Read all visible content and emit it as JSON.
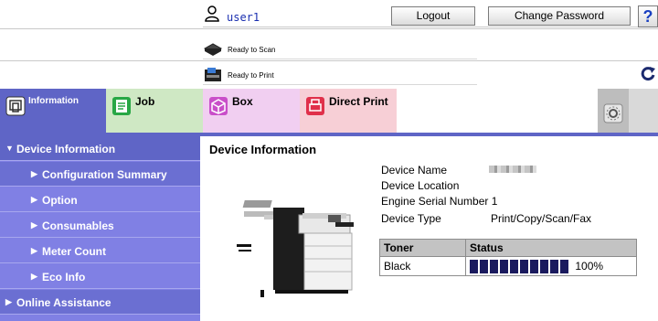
{
  "header": {
    "user_name": "user1",
    "logout_label": "Logout",
    "change_password_label": "Change Password",
    "help_label": "?",
    "scan_status": "Ready to Scan",
    "print_status": "Ready to Print"
  },
  "tabs": [
    {
      "label": "Information"
    },
    {
      "label": "Job"
    },
    {
      "label": "Box"
    },
    {
      "label": "Direct Print"
    }
  ],
  "sidebar": {
    "items": [
      {
        "label": "Device Information"
      },
      {
        "label": "Configuration Summary"
      },
      {
        "label": "Option"
      },
      {
        "label": "Consumables"
      },
      {
        "label": "Meter Count"
      },
      {
        "label": "Eco Info"
      },
      {
        "label": "Online Assistance"
      }
    ]
  },
  "main": {
    "title": "Device Information",
    "fields": [
      {
        "label": "Device Name",
        "value": ""
      },
      {
        "label": "Device Location",
        "value": ""
      },
      {
        "label": "Engine Serial Number 1",
        "value": ""
      },
      {
        "label": "Device Type",
        "value": "Print/Copy/Scan/Fax"
      }
    ],
    "toner_table": {
      "headers": [
        "Toner",
        "Status"
      ],
      "rows": [
        {
          "toner": "Black",
          "level_percent": 100,
          "level_text": "100%"
        }
      ]
    }
  },
  "colors": {
    "accent": "#5f65c6",
    "sidebar": "#8080e4",
    "job_tab": "#cfe8c4",
    "box_tab": "#f1cff1",
    "direct_print_tab": "#f7cfd6",
    "toner_fill": "#1a1a5e"
  },
  "icons": [
    "user-icon",
    "scanner-icon",
    "printer-icon",
    "refresh-icon",
    "information-icon",
    "job-icon",
    "box-icon",
    "direct-print-icon",
    "settings-icon"
  ]
}
